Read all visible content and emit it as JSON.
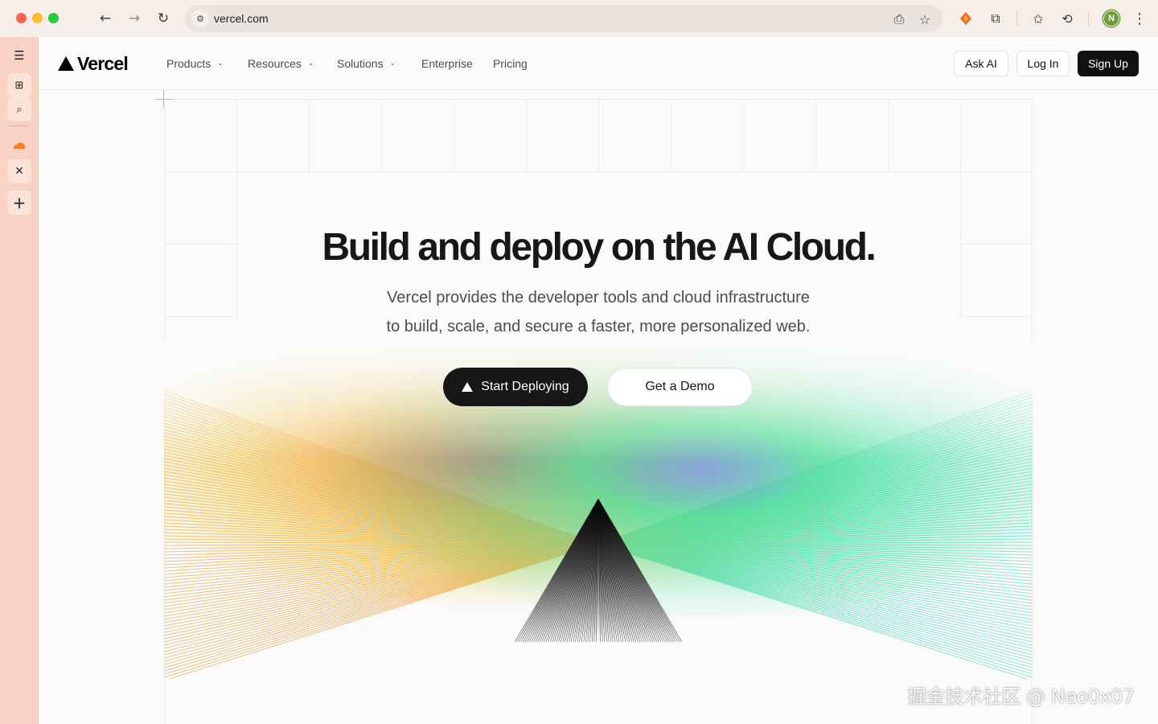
{
  "browser": {
    "url": "vercel.com",
    "profile_initial": "N"
  },
  "nav": {
    "logo_text": "Vercel",
    "menu": [
      {
        "label": "Products",
        "has_dropdown": true
      },
      {
        "label": "Resources",
        "has_dropdown": true
      },
      {
        "label": "Solutions",
        "has_dropdown": true
      },
      {
        "label": "Enterprise",
        "has_dropdown": false
      },
      {
        "label": "Pricing",
        "has_dropdown": false
      }
    ],
    "ask_ai": "Ask AI",
    "log_in": "Log In",
    "sign_up": "Sign Up"
  },
  "hero": {
    "title": "Build and deploy on the AI Cloud.",
    "subtitle_line1": "Vercel provides the developer tools and cloud infrastructure",
    "subtitle_line2": "to build, scale, and secure a faster, more personalized web.",
    "primary_cta": "Start Deploying",
    "secondary_cta": "Get a Demo"
  },
  "watermark": "掘金技术社区 @ Neo0x07",
  "colors": {
    "brand_black": "#171717",
    "side_panel": "#f8d2c2",
    "spectrum_orange": "#e8a04a",
    "spectrum_yellow": "#f0c93a",
    "spectrum_red": "#f2545b",
    "spectrum_blue": "#5b8cf5",
    "spectrum_green": "#3ee0a0"
  }
}
